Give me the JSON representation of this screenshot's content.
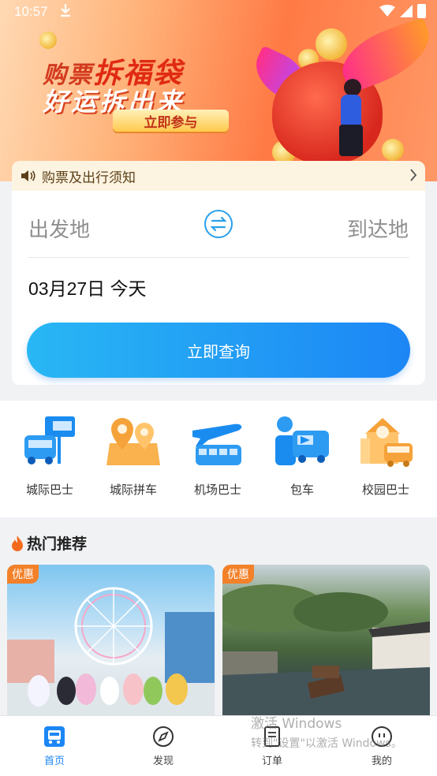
{
  "status_bar": {
    "time": "10:57"
  },
  "banner": {
    "line1_a": "购票",
    "line1_b": "拆福袋",
    "line2": "好运拆出来",
    "cta": "立即参与"
  },
  "notice": {
    "text": "购票及出行须知"
  },
  "search": {
    "from_placeholder": "出发地",
    "to_placeholder": "到达地",
    "date": "03月27日 今天",
    "query_button": "立即查询"
  },
  "categories": [
    {
      "label": "城际巴士",
      "icon": "intercity-bus-icon"
    },
    {
      "label": "城际拼车",
      "icon": "carpool-map-icon"
    },
    {
      "label": "机场巴士",
      "icon": "airport-bus-icon"
    },
    {
      "label": "包车",
      "icon": "charter-icon"
    },
    {
      "label": "校园巴士",
      "icon": "campus-bus-icon"
    }
  ],
  "hot": {
    "title": "热门推荐",
    "tiles": [
      {
        "badge": "优惠"
      },
      {
        "badge": "优惠"
      }
    ]
  },
  "nav": [
    {
      "label": "首页",
      "active": true
    },
    {
      "label": "发现"
    },
    {
      "label": "订单"
    },
    {
      "label": "我的"
    }
  ],
  "watermark": {
    "line1": "激活 Windows",
    "line2": "转到\"设置\"以激活 Windows。"
  },
  "colors": {
    "accent": "#1c86f5",
    "badge": "#f3812a",
    "notice_bg": "#fdf3e1"
  }
}
